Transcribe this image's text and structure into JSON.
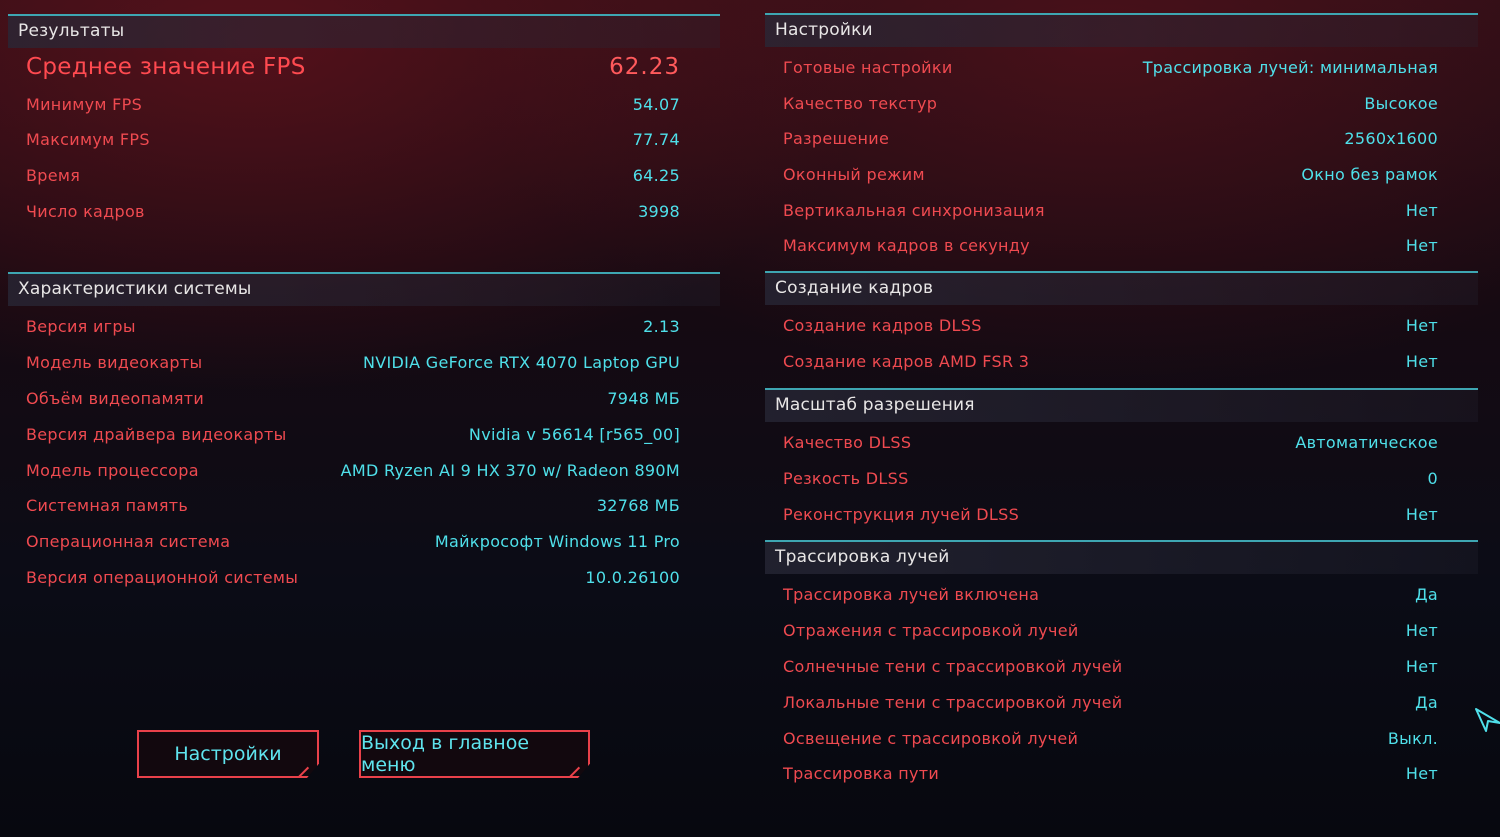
{
  "results": {
    "title": "Результаты",
    "avg_fps": {
      "label": "Среднее значение FPS",
      "value": "62.23"
    },
    "rows": [
      {
        "label": "Минимум FPS",
        "value": "54.07"
      },
      {
        "label": "Максимум FPS",
        "value": "77.74"
      },
      {
        "label": "Время",
        "value": "64.25"
      },
      {
        "label": "Число кадров",
        "value": "3998"
      }
    ]
  },
  "system": {
    "title": "Характеристики системы",
    "rows": [
      {
        "label": "Версия игры",
        "value": "2.13"
      },
      {
        "label": "Модель видеокарты",
        "value": "NVIDIA GeForce RTX 4070 Laptop GPU"
      },
      {
        "label": "Объём видеопамяти",
        "value": "7948 МБ"
      },
      {
        "label": "Версия драйвера видеокарты",
        "value": "Nvidia v 56614 [r565_00]"
      },
      {
        "label": "Модель процессора",
        "value": "AMD Ryzen AI 9 HX 370 w/ Radeon 890M"
      },
      {
        "label": "Системная память",
        "value": "32768 МБ"
      },
      {
        "label": "Операционная система",
        "value": "Майкрософт Windows 11 Pro"
      },
      {
        "label": "Версия операционной системы",
        "value": "10.0.26100"
      }
    ]
  },
  "buttons": {
    "settings": "Настройки",
    "exit": "Выход в главное меню"
  },
  "settings": {
    "title": "Настройки",
    "rows": [
      {
        "label": "Готовые настройки",
        "value": "Трассировка лучей: минимальная"
      },
      {
        "label": "Качество текстур",
        "value": "Высокое"
      },
      {
        "label": "Разрешение",
        "value": "2560x1600"
      },
      {
        "label": "Оконный режим",
        "value": "Окно без рамок"
      },
      {
        "label": "Вертикальная синхронизация",
        "value": "Нет"
      },
      {
        "label": "Максимум кадров в секунду",
        "value": "Нет"
      }
    ]
  },
  "frame_gen": {
    "title": "Создание кадров",
    "rows": [
      {
        "label": "Создание кадров DLSS",
        "value": "Нет"
      },
      {
        "label": "Создание кадров AMD FSR 3",
        "value": "Нет"
      }
    ]
  },
  "scaling": {
    "title": "Масштаб разрешения",
    "rows": [
      {
        "label": "Качество DLSS",
        "value": "Автоматическое"
      },
      {
        "label": "Резкость DLSS",
        "value": "0"
      },
      {
        "label": "Реконструкция лучей DLSS",
        "value": "Нет"
      }
    ]
  },
  "raytracing": {
    "title": "Трассировка лучей",
    "rows": [
      {
        "label": "Трассировка лучей включена",
        "value": "Да"
      },
      {
        "label": "Отражения с трассировкой лучей",
        "value": "Нет"
      },
      {
        "label": "Солнечные тени с трассировкой лучей",
        "value": "Нет"
      },
      {
        "label": "Локальные тени с трассировкой лучей",
        "value": "Да"
      },
      {
        "label": "Освещение с трассировкой лучей",
        "value": "Выкл."
      },
      {
        "label": "Трассировка пути",
        "value": "Нет"
      }
    ]
  }
}
